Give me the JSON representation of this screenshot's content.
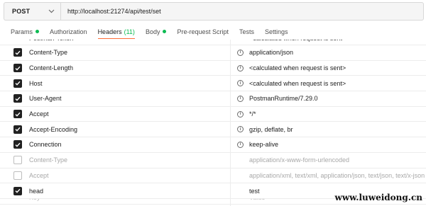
{
  "request": {
    "method": "POST",
    "url": "http://localhost:21274/api/test/set"
  },
  "tabs": [
    {
      "label": "Params",
      "dot": true
    },
    {
      "label": "Authorization",
      "dot": false
    },
    {
      "label": "Headers",
      "count": "(11)",
      "active": true
    },
    {
      "label": "Body",
      "dot": true
    },
    {
      "label": "Pre-request Script",
      "dot": false
    },
    {
      "label": "Tests",
      "dot": false
    },
    {
      "label": "Settings",
      "dot": false
    }
  ],
  "headers": [
    {
      "key": "Postman-Token",
      "value": "<calculated when request is sent>",
      "checked": true,
      "info": true,
      "partial": true
    },
    {
      "key": "Content-Type",
      "value": "application/json",
      "checked": true,
      "info": true
    },
    {
      "key": "Content-Length",
      "value": "<calculated when request is sent>",
      "checked": true,
      "info": true
    },
    {
      "key": "Host",
      "value": "<calculated when request is sent>",
      "checked": true,
      "info": true
    },
    {
      "key": "User-Agent",
      "value": "PostmanRuntime/7.29.0",
      "checked": true,
      "info": true
    },
    {
      "key": "Accept",
      "value": "*/*",
      "checked": true,
      "info": true
    },
    {
      "key": "Accept-Encoding",
      "value": "gzip, deflate, br",
      "checked": true,
      "info": true
    },
    {
      "key": "Connection",
      "value": "keep-alive",
      "checked": true,
      "info": true
    },
    {
      "key": "Content-Type",
      "value": "application/x-www-form-urlencoded",
      "checked": false,
      "info": false,
      "disabled": true
    },
    {
      "key": "Accept",
      "value": "application/xml, text/xml, application/json, text/json, text/x-json",
      "checked": false,
      "info": false,
      "disabled": true
    },
    {
      "key": "head",
      "value": "test",
      "checked": true,
      "info": false
    },
    {
      "key": "Key",
      "value": "Value",
      "checked": false,
      "info": false,
      "placeholder": true,
      "partial": true
    }
  ],
  "info_glyph": "i",
  "icons": {
    "method_dropdown": "chevron-down-icon",
    "checkbox": "checkmark-icon",
    "info": "info-icon"
  },
  "colors": {
    "accent": "#ff6c37",
    "status_dot": "#0cbb52"
  },
  "watermark": "www.luweidong.cn"
}
